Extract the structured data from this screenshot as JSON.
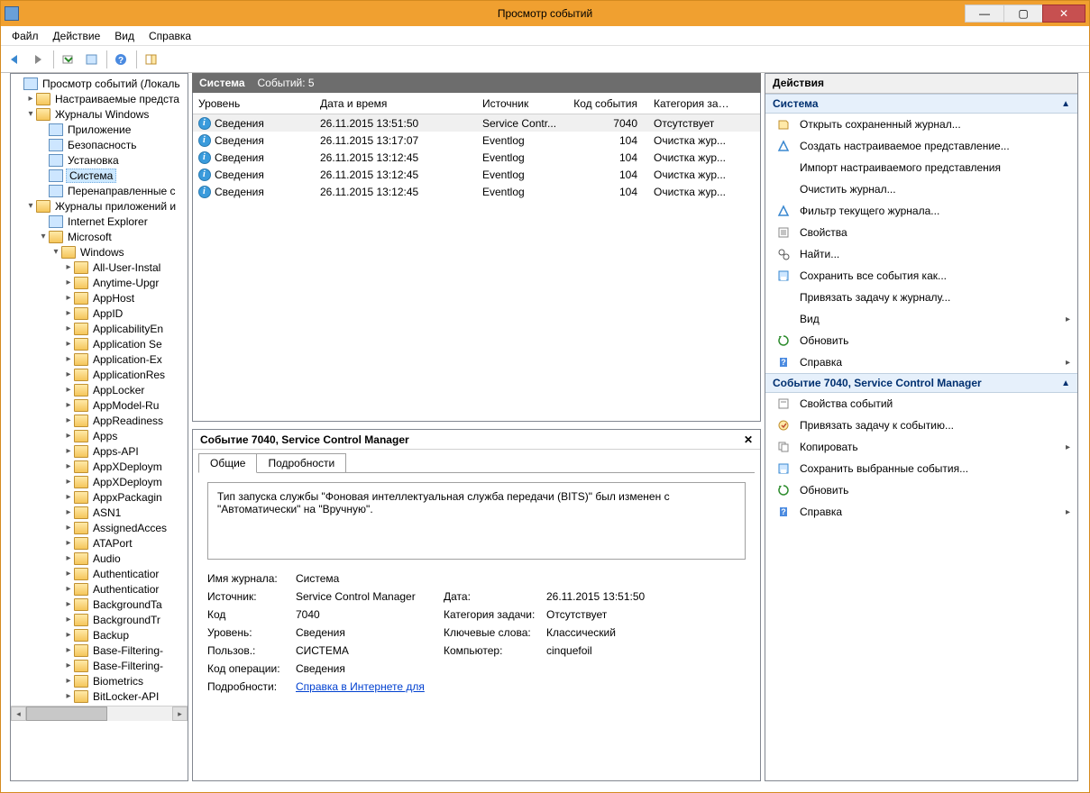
{
  "window": {
    "title": "Просмотр событий"
  },
  "menu": {
    "file": "Файл",
    "action": "Действие",
    "view": "Вид",
    "help": "Справка"
  },
  "tree": {
    "root": "Просмотр событий (Локаль",
    "custom": "Настраиваемые предста",
    "winlogs": "Журналы Windows",
    "logs_app": "Приложение",
    "logs_sec": "Безопасность",
    "logs_setup": "Установка",
    "logs_sys": "Система",
    "logs_fwd": "Перенаправленные с",
    "applogs": "Журналы приложений и",
    "ie": "Internet Explorer",
    "ms": "Microsoft",
    "windows": "Windows",
    "w_items": [
      "All-User-Instal",
      "Anytime-Upgr",
      "AppHost",
      "AppID",
      "ApplicabilityEn",
      "Application Se",
      "Application-Ex",
      "ApplicationRes",
      "AppLocker",
      "AppModel-Ru",
      "AppReadiness",
      "Apps",
      "Apps-API",
      "AppXDeploym",
      "AppXDeploym",
      "AppxPackagin",
      "ASN1",
      "AssignedAcces",
      "ATAPort",
      "Audio",
      "Authenticatior",
      "Authenticatior",
      "BackgroundTa",
      "BackgroundTr",
      "Backup",
      "Base-Filtering-",
      "Base-Filtering-",
      "Biometrics",
      "BitLocker-API"
    ]
  },
  "main": {
    "header_name": "Система",
    "header_count": "Событий: 5",
    "columns": {
      "level": "Уровень",
      "datetime": "Дата и время",
      "source": "Источник",
      "eventid": "Код события",
      "category": "Категория зад..."
    },
    "rows": [
      {
        "level": "Сведения",
        "datetime": "26.11.2015 13:51:50",
        "source": "Service Contr...",
        "eventid": "7040",
        "category": "Отсутствует"
      },
      {
        "level": "Сведения",
        "datetime": "26.11.2015 13:17:07",
        "source": "Eventlog",
        "eventid": "104",
        "category": "Очистка жур..."
      },
      {
        "level": "Сведения",
        "datetime": "26.11.2015 13:12:45",
        "source": "Eventlog",
        "eventid": "104",
        "category": "Очистка жур..."
      },
      {
        "level": "Сведения",
        "datetime": "26.11.2015 13:12:45",
        "source": "Eventlog",
        "eventid": "104",
        "category": "Очистка жур..."
      },
      {
        "level": "Сведения",
        "datetime": "26.11.2015 13:12:45",
        "source": "Eventlog",
        "eventid": "104",
        "category": "Очистка жур..."
      }
    ]
  },
  "detail": {
    "title": "Событие 7040, Service Control Manager",
    "tabs": {
      "general": "Общие",
      "details": "Подробности"
    },
    "message": "Тип запуска службы \"Фоновая интеллектуальная служба передачи (BITS)\" был изменен с \"Автоматически\" на \"Вручную\".",
    "labels": {
      "logname": "Имя журнала:",
      "logname_v": "Система",
      "source": "Источник:",
      "source_v": "Service Control Manager",
      "logged": "Дата:",
      "logged_v": "26.11.2015 13:51:50",
      "eventid": "Код",
      "eventid_v": "7040",
      "taskcat": "Категория задачи:",
      "taskcat_v": "Отсутствует",
      "level": "Уровень:",
      "level_v": "Сведения",
      "keywords": "Ключевые слова:",
      "keywords_v": "Классический",
      "user": "Пользов.:",
      "user_v": "СИСТЕМА",
      "computer": "Компьютер:",
      "computer_v": "cinquefoil",
      "opcode": "Код операции:",
      "opcode_v": "Сведения",
      "more": "Подробности:",
      "more_link": "Справка в Интернете для "
    }
  },
  "actions": {
    "title": "Действия",
    "sec1": "Система",
    "items1": [
      "Открыть сохраненный журнал...",
      "Создать настраиваемое представление...",
      "Импорт настраиваемого представления",
      "Очистить журнал...",
      "Фильтр текущего журнала...",
      "Свойства",
      "Найти...",
      "Сохранить все события как...",
      "Привязать задачу к журналу...",
      "Вид",
      "Обновить",
      "Справка"
    ],
    "sec2": "Событие 7040, Service Control Manager",
    "items2": [
      "Свойства событий",
      "Привязать задачу к событию...",
      "Копировать",
      "Сохранить выбранные события...",
      "Обновить",
      "Справка"
    ]
  }
}
